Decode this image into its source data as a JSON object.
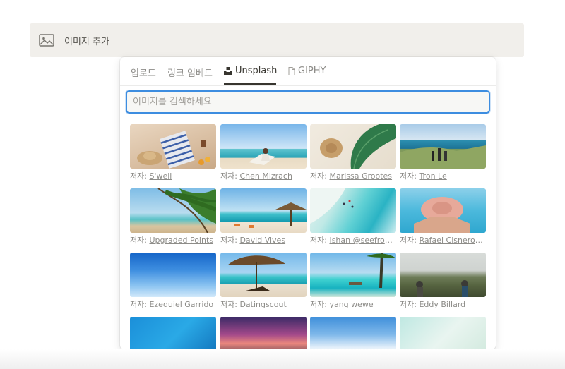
{
  "add_image": {
    "label": "이미지 추가",
    "icon": "image-icon"
  },
  "tabs": [
    {
      "label": "업로드",
      "active": false
    },
    {
      "label": "링크 임베드",
      "active": false
    },
    {
      "label": "Unsplash",
      "active": true,
      "icon": "unsplash-icon"
    },
    {
      "label": "GIPHY",
      "active": false,
      "icon": "file-icon"
    }
  ],
  "search": {
    "placeholder": "이미지를 검색하세요",
    "value": ""
  },
  "credit_prefix": "저자: ",
  "images": [
    {
      "author": "S'well"
    },
    {
      "author": "Chen Mizrach"
    },
    {
      "author": "Marissa Grootes"
    },
    {
      "author": "Tron Le"
    },
    {
      "author": "Upgraded Points"
    },
    {
      "author": "David Vives"
    },
    {
      "author": "Ishan @seefromthesky"
    },
    {
      "author": "Rafael Cisneros Méndez"
    },
    {
      "author": "Ezequiel Garrido"
    },
    {
      "author": "Datingscout"
    },
    {
      "author": "yang wewe"
    },
    {
      "author": "Eddy Billard"
    },
    {
      "author": ""
    },
    {
      "author": ""
    },
    {
      "author": ""
    },
    {
      "author": ""
    }
  ],
  "colors": {
    "focus_ring": "#3d8de0",
    "bar_bg": "#f1efeb",
    "text_primary": "#37352f",
    "text_secondary": "#8d8c88"
  }
}
